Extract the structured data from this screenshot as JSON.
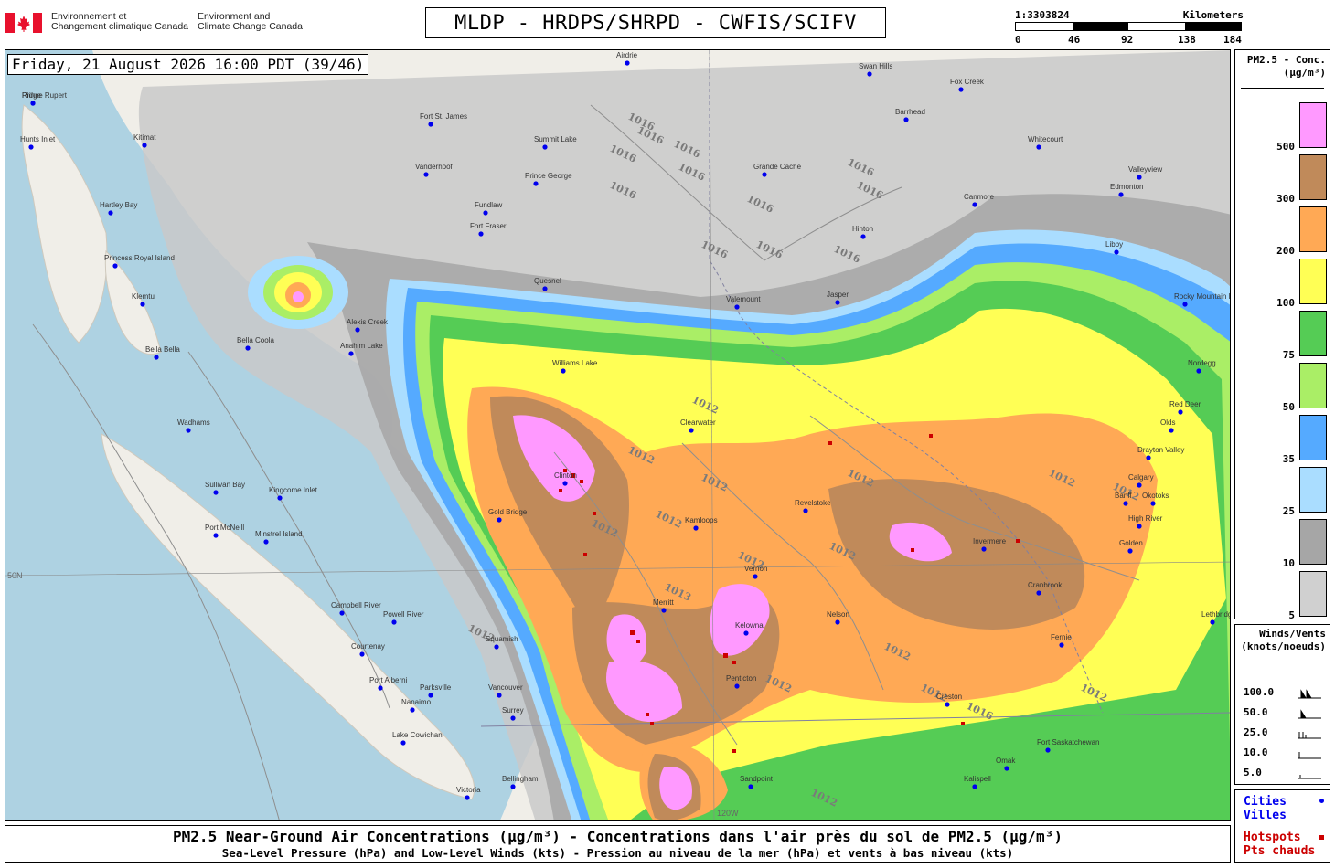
{
  "header": {
    "dept_fr_line1": "Environnement et",
    "dept_fr_line2": "Changement climatique Canada",
    "dept_en_line1": "Environment and",
    "dept_en_line2": "Climate Change Canada",
    "title": "MLDP - HRDPS/SHRPD - CWFIS/SCIFV"
  },
  "scale": {
    "ratio": "1:3303824",
    "unit": "Kilometers",
    "ticks": [
      "0",
      "46",
      "92",
      "138",
      "184"
    ]
  },
  "timestamp": "Friday, 21 August 2026 16:00 PDT (39/46)",
  "legend": {
    "conc_title_1": "PM2.5 - Conc.",
    "conc_title_2": "(µg/m³)",
    "bins": [
      {
        "label": "500",
        "color": "#ff99ff"
      },
      {
        "label": "300",
        "color": "#c08a5a"
      },
      {
        "label": "200",
        "color": "#ffa955"
      },
      {
        "label": "100",
        "color": "#ffff55"
      },
      {
        "label": "75",
        "color": "#55cc55"
      },
      {
        "label": "50",
        "color": "#aaee66"
      },
      {
        "label": "35",
        "color": "#55aaff"
      },
      {
        "label": "25",
        "color": "#aaddff"
      },
      {
        "label": "10",
        "color": "#a6a6a6"
      },
      {
        "label": "5",
        "color": "#d0d0d0"
      }
    ],
    "wind_title_1": "Winds/Vents",
    "wind_title_2": "(knots/noeuds)",
    "wind_speeds": [
      "100.0",
      "50.0",
      "25.0",
      "10.0",
      "5.0"
    ],
    "cities_en": "Cities",
    "cities_fr": "Villes",
    "hotspots_en": "Hotspots",
    "hotspots_fr": "Pts chauds",
    "city_color": "#0000ee",
    "hotspot_color": "#cc0000"
  },
  "footer": {
    "line1": "PM2.5 Near-Ground Air Concentrations (µg/m³) - Concentrations dans l'air près du sol de PM2.5 (µg/m³)",
    "line2": "Sea-Level Pressure (hPa) and Low-Level Winds (kts) - Pression au niveau de la mer (hPa) et vents à bas niveau (kts)"
  },
  "map": {
    "isobar_labels": [
      "1016",
      "1016",
      "1016",
      "1016",
      "1016",
      "1016",
      "1016",
      "1016",
      "1016",
      "1016",
      "1016",
      "1016",
      "1012",
      "1012",
      "1012",
      "1012",
      "1012",
      "1012",
      "1012",
      "1012",
      "1012",
      "1012",
      "1013",
      "1012",
      "1012",
      "1012",
      "1012",
      "1012",
      "1012",
      "1016"
    ],
    "graticule_labels": [
      "50N",
      "120W"
    ],
    "places": [
      "Prince Rupert",
      "Hunts Inlet",
      "Kitimat",
      "Hartley Bay",
      "Princess Royal Island",
      "Klemtu",
      "Bella Bella",
      "Wadhams",
      "Sullivan Bay",
      "Kingcome Inlet",
      "Port McNeill",
      "Minstrel Island",
      "Campbell River",
      "Powell River",
      "Courtenay",
      "Port Alberni",
      "Parksville",
      "Nanaimo",
      "Lake Cowichan",
      "Victoria",
      "Vancouver",
      "Surrey",
      "Bellingham",
      "Squamish",
      "Gold Bridge",
      "Clinton",
      "Kamloops",
      "Merritt",
      "Kelowna",
      "Penticton",
      "Vernon",
      "Revelstoke",
      "Invermere",
      "Cranbrook",
      "Fernie",
      "Creston",
      "Nelson",
      "Valemount",
      "Jasper",
      "Hinton",
      "Grande Cache",
      "Prince George",
      "Vanderhoof",
      "Fort St. James",
      "Summit Lake",
      "Fort Fraser",
      "Fundlaw",
      "Quesnel",
      "Williams Lake",
      "Alexis Creek",
      "Anahim Lake",
      "Bella Coola",
      "Clearwater",
      "Edmonton",
      "Red Deer",
      "Calgary",
      "Banff",
      "Golden",
      "Lethbridge",
      "High River",
      "Okotoks",
      "Canmore",
      "Whitecourt",
      "Barrhead",
      "Fox Creek",
      "Swan Hills",
      "Valleyview",
      "Fort Saskatchewan",
      "Kalispell",
      "Sandpoint",
      "Omak",
      "Libby",
      "Nordegg",
      "Rocky Mountain House",
      "Drayton Valley",
      "Olds",
      "Airdrie",
      "Ridge"
    ]
  }
}
